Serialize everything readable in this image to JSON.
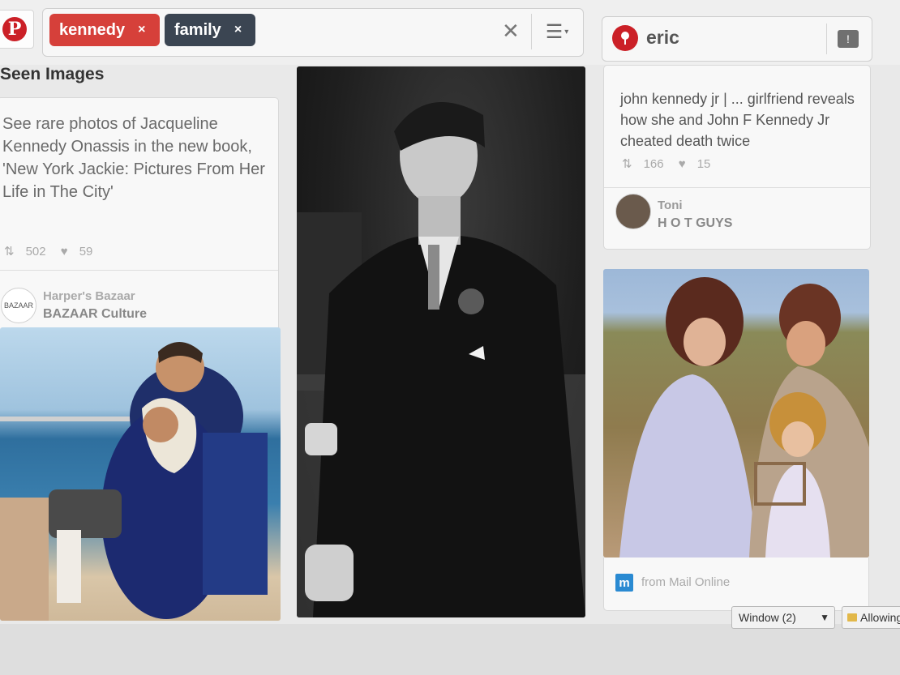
{
  "search": {
    "tokens": [
      {
        "label": "kennedy",
        "color": "#d6403a"
      },
      {
        "label": "family",
        "color": "#3b4552"
      }
    ],
    "remove_glyph": "×",
    "clear_glyph": "✕",
    "menu_glyph": "☰"
  },
  "user": {
    "name": "eric",
    "pin_glyph": "📍"
  },
  "left_column": {
    "header": "Seen Images",
    "pin": {
      "description": "See rare photos of Jacqueline Kennedy Onassis in the new book, 'New York Jackie: Pictures From Her Life in The City'",
      "repins": "502",
      "likes": "59",
      "source_name": "Harper's Bazaar",
      "board": "BAZAAR Culture",
      "avatar_text": "BAZAAR"
    }
  },
  "right_column": {
    "pin": {
      "description": "john kennedy jr | ... girlfriend reveals how she and John F Kennedy Jr cheated death twice",
      "repins": "166",
      "likes": "15",
      "pinner_name": "Toni",
      "board": "H O T GUYS"
    },
    "second_pin": {
      "source_icon_letter": "m",
      "source_text": "from Mail Online"
    }
  },
  "browser_bar": {
    "window_button": "Window (2)",
    "allowing_button": "Allowing"
  },
  "colors": {
    "brand_red": "#cb2027",
    "background": "#e9e9e9"
  }
}
